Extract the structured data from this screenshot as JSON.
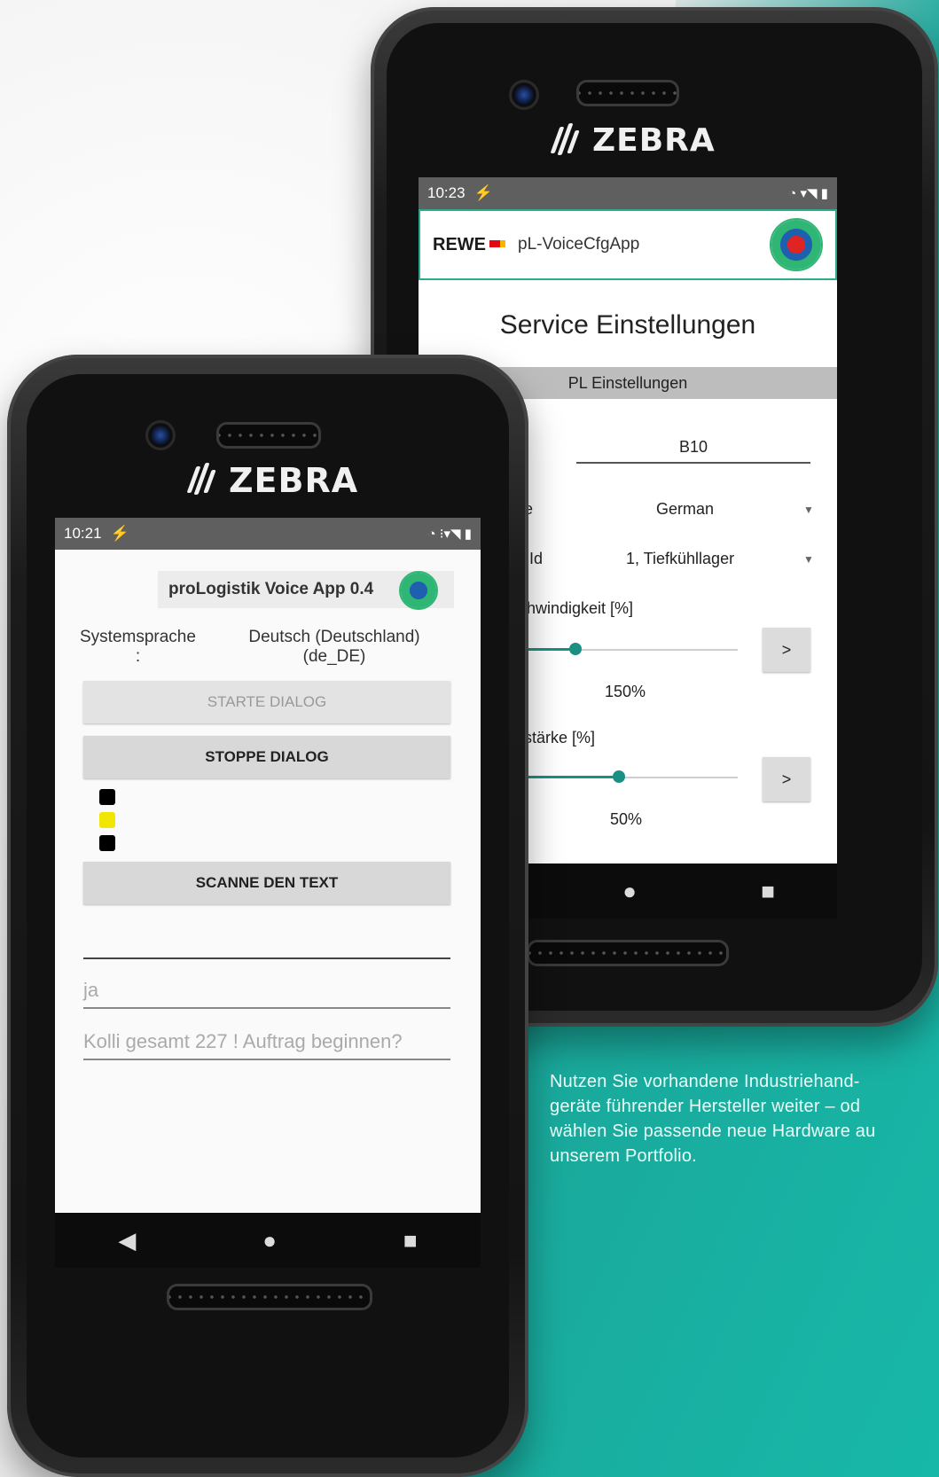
{
  "colors": {
    "teal": "#17b3a3",
    "accent": "#1a8f83",
    "zebra_text": "#f0f0f0"
  },
  "brand": "ZEBRA",
  "back_phone": {
    "status": {
      "time": "10:23",
      "icons": "◔ ▾◥ ▮"
    },
    "header": {
      "partner": "REWE",
      "app_title": "pL-VoiceCfgApp",
      "logo_icon": "app-logo-icon"
    },
    "title": "Service Einstellungen",
    "section": "PL Einstellungen",
    "field_value": "B10",
    "rows": [
      {
        "label": "che",
        "value": "German"
      },
      {
        "label": "er Id",
        "value": "1, Tiefkühllager"
      }
    ],
    "speed": {
      "label": "schwindigkeit [%]",
      "value": "150%",
      "level": 0.25,
      "button": ">"
    },
    "volume": {
      "label": "utstärke [%]",
      "value": "50%",
      "level": 0.45,
      "button": ">"
    },
    "nav": {
      "back": "◀",
      "home": "●",
      "recent": "■"
    }
  },
  "front_phone": {
    "status": {
      "time": "10:21",
      "icons": "◔ ⁝▾◥ ▮"
    },
    "app_title": "proLogistik Voice App 0.4",
    "system_language_label": "Systemsprache\n:",
    "system_language_value": "Deutsch (Deutschland)\n(de_DE)",
    "buttons": {
      "start": "STARTE DIALOG",
      "stop": "STOPPE DIALOG",
      "scan": "SCANNE DEN TEXT"
    },
    "indicators": [
      "#000000",
      "#f2e600",
      "#000000"
    ],
    "field_empty": "",
    "field_answer": "ja",
    "field_prompt": "Kolli gesamt 227 !  Auftrag beginnen?",
    "nav": {
      "back": "◀",
      "home": "●",
      "recent": "■"
    }
  },
  "caption": {
    "line1": "Nutzen Sie vorhandene Industriehand-",
    "line2": "geräte führender Hersteller weiter – od",
    "line3": "wählen Sie passende neue Hardware au",
    "line4": "unserem Portfolio."
  }
}
